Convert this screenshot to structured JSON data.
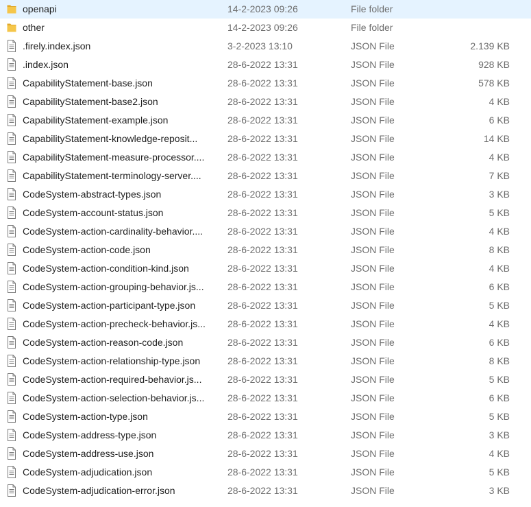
{
  "colors": {
    "folder": "#f5c64a",
    "folder_dark": "#e0a92c",
    "file_outline": "#7a7a7a",
    "secondary_text": "#6d6d6d",
    "hover": "#e5f3ff"
  },
  "files": [
    {
      "name": "openapi",
      "date": "14-2-2023 09:26",
      "type": "File folder",
      "size": "",
      "icon": "folder-icon"
    },
    {
      "name": "other",
      "date": "14-2-2023 09:26",
      "type": "File folder",
      "size": "",
      "icon": "folder-icon"
    },
    {
      "name": ".firely.index.json",
      "date": "3-2-2023 13:10",
      "type": "JSON File",
      "size": "2.139 KB",
      "icon": "file-icon"
    },
    {
      "name": ".index.json",
      "date": "28-6-2022 13:31",
      "type": "JSON File",
      "size": "928 KB",
      "icon": "file-icon"
    },
    {
      "name": "CapabilityStatement-base.json",
      "date": "28-6-2022 13:31",
      "type": "JSON File",
      "size": "578 KB",
      "icon": "file-icon"
    },
    {
      "name": "CapabilityStatement-base2.json",
      "date": "28-6-2022 13:31",
      "type": "JSON File",
      "size": "4 KB",
      "icon": "file-icon"
    },
    {
      "name": "CapabilityStatement-example.json",
      "date": "28-6-2022 13:31",
      "type": "JSON File",
      "size": "6 KB",
      "icon": "file-icon"
    },
    {
      "name": "CapabilityStatement-knowledge-reposit...",
      "date": "28-6-2022 13:31",
      "type": "JSON File",
      "size": "14 KB",
      "icon": "file-icon"
    },
    {
      "name": "CapabilityStatement-measure-processor....",
      "date": "28-6-2022 13:31",
      "type": "JSON File",
      "size": "4 KB",
      "icon": "file-icon"
    },
    {
      "name": "CapabilityStatement-terminology-server....",
      "date": "28-6-2022 13:31",
      "type": "JSON File",
      "size": "7 KB",
      "icon": "file-icon"
    },
    {
      "name": "CodeSystem-abstract-types.json",
      "date": "28-6-2022 13:31",
      "type": "JSON File",
      "size": "3 KB",
      "icon": "file-icon"
    },
    {
      "name": "CodeSystem-account-status.json",
      "date": "28-6-2022 13:31",
      "type": "JSON File",
      "size": "5 KB",
      "icon": "file-icon"
    },
    {
      "name": "CodeSystem-action-cardinality-behavior....",
      "date": "28-6-2022 13:31",
      "type": "JSON File",
      "size": "4 KB",
      "icon": "file-icon"
    },
    {
      "name": "CodeSystem-action-code.json",
      "date": "28-6-2022 13:31",
      "type": "JSON File",
      "size": "8 KB",
      "icon": "file-icon"
    },
    {
      "name": "CodeSystem-action-condition-kind.json",
      "date": "28-6-2022 13:31",
      "type": "JSON File",
      "size": "4 KB",
      "icon": "file-icon"
    },
    {
      "name": "CodeSystem-action-grouping-behavior.js...",
      "date": "28-6-2022 13:31",
      "type": "JSON File",
      "size": "6 KB",
      "icon": "file-icon"
    },
    {
      "name": "CodeSystem-action-participant-type.json",
      "date": "28-6-2022 13:31",
      "type": "JSON File",
      "size": "5 KB",
      "icon": "file-icon"
    },
    {
      "name": "CodeSystem-action-precheck-behavior.js...",
      "date": "28-6-2022 13:31",
      "type": "JSON File",
      "size": "4 KB",
      "icon": "file-icon"
    },
    {
      "name": "CodeSystem-action-reason-code.json",
      "date": "28-6-2022 13:31",
      "type": "JSON File",
      "size": "6 KB",
      "icon": "file-icon"
    },
    {
      "name": "CodeSystem-action-relationship-type.json",
      "date": "28-6-2022 13:31",
      "type": "JSON File",
      "size": "8 KB",
      "icon": "file-icon"
    },
    {
      "name": "CodeSystem-action-required-behavior.js...",
      "date": "28-6-2022 13:31",
      "type": "JSON File",
      "size": "5 KB",
      "icon": "file-icon"
    },
    {
      "name": "CodeSystem-action-selection-behavior.js...",
      "date": "28-6-2022 13:31",
      "type": "JSON File",
      "size": "6 KB",
      "icon": "file-icon"
    },
    {
      "name": "CodeSystem-action-type.json",
      "date": "28-6-2022 13:31",
      "type": "JSON File",
      "size": "5 KB",
      "icon": "file-icon"
    },
    {
      "name": "CodeSystem-address-type.json",
      "date": "28-6-2022 13:31",
      "type": "JSON File",
      "size": "3 KB",
      "icon": "file-icon"
    },
    {
      "name": "CodeSystem-address-use.json",
      "date": "28-6-2022 13:31",
      "type": "JSON File",
      "size": "4 KB",
      "icon": "file-icon"
    },
    {
      "name": "CodeSystem-adjudication.json",
      "date": "28-6-2022 13:31",
      "type": "JSON File",
      "size": "5 KB",
      "icon": "file-icon"
    },
    {
      "name": "CodeSystem-adjudication-error.json",
      "date": "28-6-2022 13:31",
      "type": "JSON File",
      "size": "3 KB",
      "icon": "file-icon"
    }
  ]
}
